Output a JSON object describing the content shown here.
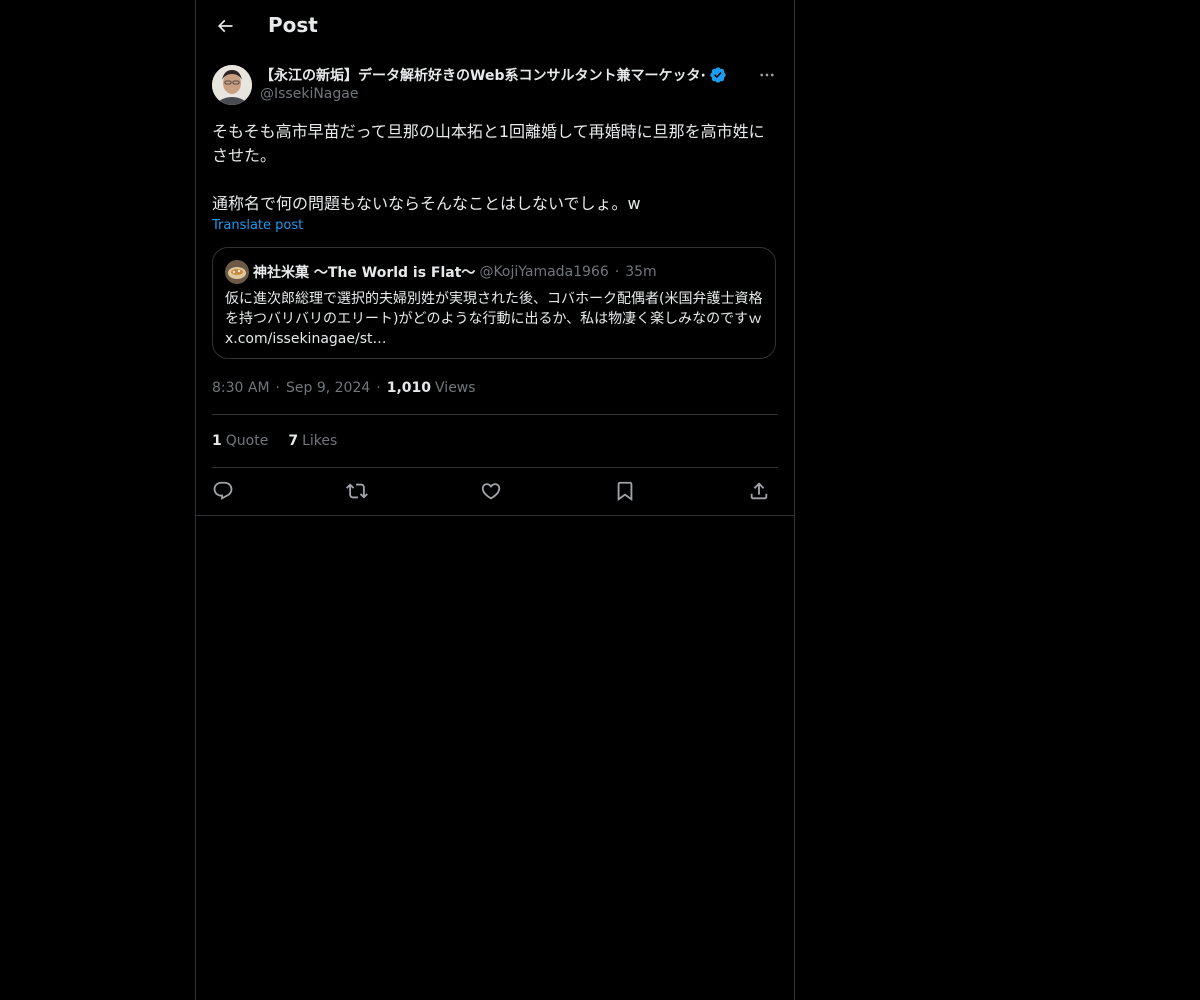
{
  "header": {
    "title": "Post",
    "back_icon": "arrow-left-icon"
  },
  "author": {
    "display_name": "【永江の新垢】データ解析好きのWeb系コンサルタント兼マーケッタ·",
    "handle": "@IssekiNagae",
    "verified": true,
    "verified_color": "#1d9bf0"
  },
  "tweet": {
    "paragraphs": [
      "そもそも高市早苗だって旦那の山本拓と1回離婚して再婚時に旦那を高市姓にさせた。",
      "通称名で何の問題もないならそんなことはしないでしょ。w"
    ],
    "translate_label": "Translate post"
  },
  "quote": {
    "name": "神社米菓 〜The World is Flat〜",
    "handle": "@KojiYamada1966",
    "separator": "·",
    "time": "35m",
    "text": "仮に進次郎総理で選択的夫婦別姓が実現された後、コバホーク配偶者(米国弁護士資格を持つバリバリのエリート)がどのような行動に出るか、私は物凄く楽しみなのですｗ x.com/issekinagae/st…"
  },
  "meta": {
    "time": "8:30 AM",
    "separator": "·",
    "date": "Sep 9, 2024",
    "views_count": "1,010",
    "views_label": "Views"
  },
  "stats": {
    "quotes_count": "1",
    "quotes_label": "Quote",
    "likes_count": "7",
    "likes_label": "Likes"
  },
  "actions": {
    "icons": [
      "reply-icon",
      "repost-icon",
      "like-icon",
      "bookmark-icon",
      "share-icon"
    ]
  },
  "colors": {
    "background": "#000000",
    "text": "#e7e9ea",
    "secondary": "#71767b",
    "accent": "#1d9bf0",
    "border": "#2f3336"
  }
}
